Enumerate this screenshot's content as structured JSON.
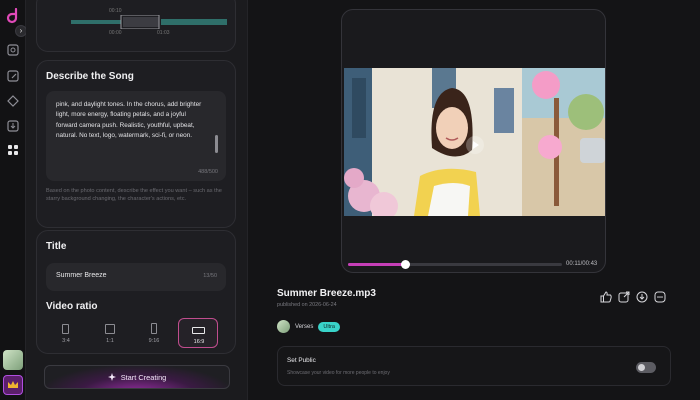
{
  "rail": {
    "logo": "d-logo-icon",
    "icons": [
      "image-icon",
      "edit-icon",
      "diamond-icon",
      "download-box-icon",
      "grid-icon"
    ],
    "collapse_icon": "chevron-right-icon"
  },
  "waveform": {
    "time_start": "00:10",
    "time_a": "00:00",
    "time_b": "01:03"
  },
  "song": {
    "heading": "Describe the Song",
    "text": "pink, and daylight tones. In the chorus, add brighter light, more energy, floating petals, and a joyful forward camera push. Realistic, youthful, upbeat, natural. No text, logo, watermark, sci-fi, or neon.",
    "count": "488/500",
    "hint": "Based on the photo content, describe the effect you want – such as the starry background changing, the character's actions, etc."
  },
  "title_card": {
    "heading": "Title",
    "value": "Summer Breeze",
    "count": "13/50",
    "ratio_heading": "Video ratio",
    "ratios": [
      "3:4",
      "1:1",
      "9:16",
      "16:9"
    ],
    "selected_ratio": "16:9"
  },
  "start_button": "Start Creating",
  "player": {
    "time": "00:11/00:43",
    "progress": 0.27
  },
  "track": {
    "title": "Summer Breeze.mp3",
    "published": "published on 2026-06-24",
    "user": "Verses",
    "badge": "Ultra"
  },
  "actions": [
    "thumbs-up-icon",
    "share-icon",
    "download-icon",
    "more-icon"
  ],
  "set_public": {
    "label": "Set Public",
    "desc": "Showcase your video for more people to enjoy",
    "enabled": false
  },
  "colors": {
    "accent": "#c63fb8",
    "badge": "#39d3c9",
    "bg": "#141416"
  }
}
